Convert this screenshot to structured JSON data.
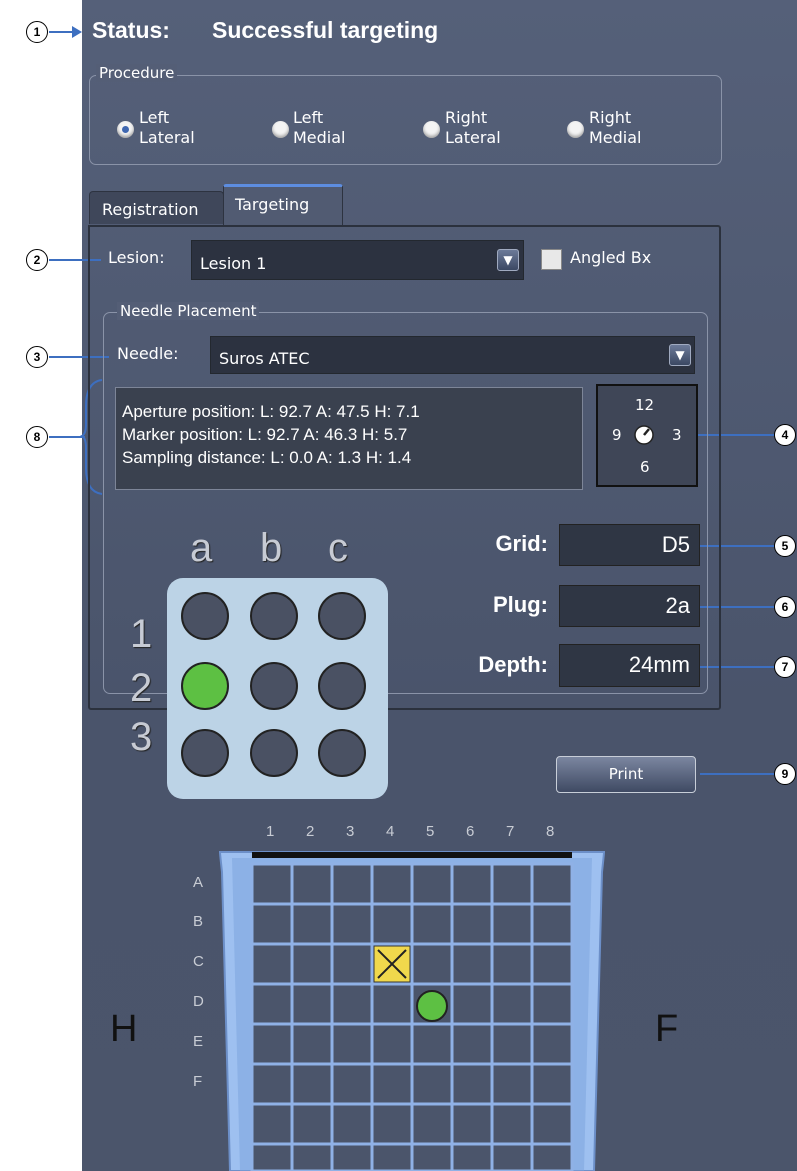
{
  "callouts": [
    "1",
    "2",
    "3",
    "4",
    "5",
    "6",
    "7",
    "8",
    "9"
  ],
  "status": {
    "label": "Status:",
    "value": "Successful targeting"
  },
  "procedure": {
    "legend": "Procedure",
    "options": [
      {
        "label": "Left\nLateral",
        "selected": true
      },
      {
        "label": "Left\nMedial",
        "selected": false
      },
      {
        "label": "Right\nLateral",
        "selected": false
      },
      {
        "label": "Right\nMedial",
        "selected": false
      }
    ]
  },
  "tabs": [
    {
      "label": "Registration",
      "active": false
    },
    {
      "label": "Targeting",
      "active": true
    }
  ],
  "lesion": {
    "label": "Lesion:",
    "value": "Lesion 1"
  },
  "angled_bx": {
    "label": "Angled Bx",
    "checked": false
  },
  "needle_placement": {
    "legend": "Needle Placement",
    "needle_label": "Needle:",
    "needle_value": "Suros ATEC",
    "info_lines": [
      "Aperture position: L: 92.7  A: 47.5  H: 7.1",
      "Marker position: L: 92.7  A: 46.3  H: 5.7",
      "Sampling distance: L: 0.0  A: 1.3  H: 1.4"
    ],
    "clock": {
      "top": "12",
      "left": "9",
      "right": "3",
      "bottom": "6"
    }
  },
  "plug_grid": {
    "columns": [
      "a",
      "b",
      "c"
    ],
    "rows": [
      "1",
      "2",
      "3"
    ],
    "selected": "2a"
  },
  "fields": {
    "grid": {
      "label": "Grid:",
      "value": "D5"
    },
    "plug": {
      "label": "Plug:",
      "value": "2a"
    },
    "depth": {
      "label": "Depth:",
      "value": "24mm"
    }
  },
  "print_label": "Print",
  "compression_grid": {
    "columns": [
      "1",
      "2",
      "3",
      "4",
      "5",
      "6",
      "7",
      "8"
    ],
    "rows": [
      "A",
      "B",
      "C",
      "D",
      "E",
      "F"
    ],
    "side_left": "H",
    "side_right": "F",
    "marker_cell": "C4",
    "target_cell": "D5"
  },
  "colors": {
    "accent": "#3d6fc0",
    "selected_plug": "#5dc043",
    "marker": "#f0d84c",
    "grid_blue": "#8fb1e6"
  }
}
